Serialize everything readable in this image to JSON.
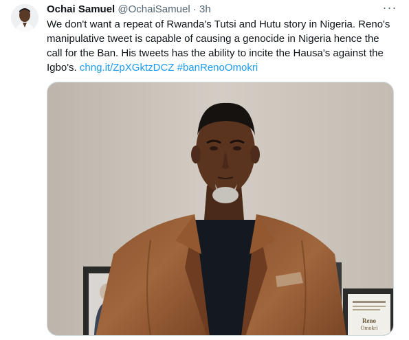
{
  "tweet": {
    "display_name": "Ochai Samuel",
    "handle": "@OchaiSamuel",
    "separator": "·",
    "timestamp": "3h",
    "more_icon": "more-horizontal-icon",
    "text_parts": [
      "We don't want a repeat of Rwanda's  Tutsi and Hutu story in Nigeria. Reno's manipulative tweet is capable of causing a genocide in Nigeria hence the call for the Ban. His tweets has the ability to incite the Hausa's against the Igbo's. "
    ],
    "link_text": "chng.it/ZpXGktzDCZ",
    "hashtag_text": "#banRenoOmokri",
    "photo_plaque_text": [
      "Reno",
      "Omokri"
    ]
  },
  "colors": {
    "link": "#1d9bf0",
    "text": "#0f1419",
    "secondary_text": "#536471",
    "media_border": "#cfd9de",
    "background": "#ffffff"
  }
}
